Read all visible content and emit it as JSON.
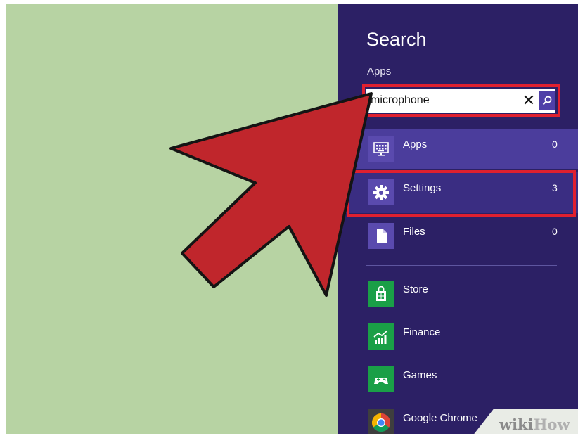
{
  "charm": {
    "title": "Search",
    "scope": "Apps",
    "query_value": "microphone",
    "clear_symbol": "✕",
    "search_icon": "search-icon"
  },
  "results": [
    {
      "label": "Apps",
      "count": "0",
      "icon": "keyboard-monitor-icon",
      "state": "selected"
    },
    {
      "label": "Settings",
      "count": "3",
      "icon": "gear-icon",
      "state": "highlighted"
    },
    {
      "label": "Files",
      "count": "0",
      "icon": "file-icon",
      "state": "normal"
    }
  ],
  "apps": [
    {
      "label": "Store",
      "icon": "store-bag-icon"
    },
    {
      "label": "Finance",
      "icon": "finance-chart-icon"
    },
    {
      "label": "Games",
      "icon": "gamepad-icon"
    },
    {
      "label": "Google Chrome",
      "icon": "chrome-icon"
    }
  ],
  "watermark": {
    "wiki": "wiki",
    "how": "How"
  },
  "colors": {
    "desktop": "#b7d3a3",
    "charm_background": "#2c2065",
    "selected_row": "#4b3d9c",
    "highlight": "#e0202f",
    "arrow_fill": "#c0262c",
    "app_tile_green": "#1a9f47"
  }
}
